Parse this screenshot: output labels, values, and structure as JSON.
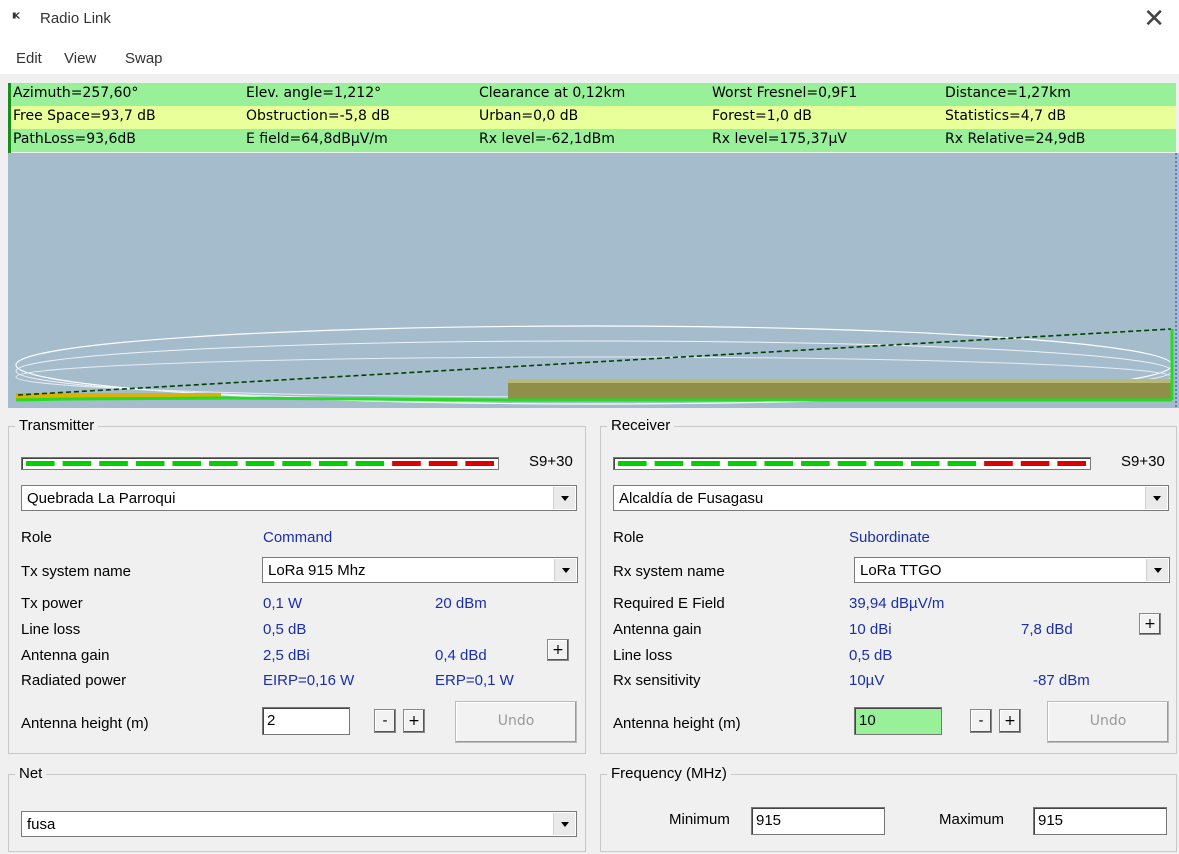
{
  "window": {
    "title": "Radio Link",
    "icon": "radio-link-app-icon",
    "close_glyph": "✕"
  },
  "menu": [
    "Edit",
    "View",
    "Swap"
  ],
  "stats": [
    [
      "Azimuth=257,60°",
      "Elev. angle=1,212°",
      "Clearance at 0,12km",
      "Worst Fresnel=0,9F1",
      "Distance=1,27km"
    ],
    [
      "Free Space=93,7 dB",
      "Obstruction=-5,8 dB",
      "Urban=0,0 dB",
      "Forest=1,0 dB",
      "Statistics=4,7 dB"
    ],
    [
      "PathLoss=93,6dB",
      "E field=64,8dBµV/m",
      "Rx level=-62,1dBm",
      "Rx level=175,37µV",
      "Rx Relative=24,9dB"
    ]
  ],
  "colors": {
    "stat_green": "#98f098",
    "stat_yellow": "#e8ff9a",
    "profile_bg": "#a5bccd",
    "meter_green": "#00d000",
    "meter_red": "#dd0000",
    "value_blue": "#1a2fa8"
  },
  "transmitter": {
    "title": "Transmitter",
    "signal_label": "S9+30",
    "meter": {
      "green_segments": 10,
      "red_segments": 3
    },
    "site": "Quebrada La Parroqui",
    "role_label": "Role",
    "role_value": "Command",
    "system_label": "Tx system name",
    "system_value": "LoRa 915 Mhz",
    "power_label": "Tx power",
    "power_w": "0,1 W",
    "power_dbm": "20 dBm",
    "line_loss_label": "Line loss",
    "line_loss_value": "0,5 dB",
    "gain_label": "Antenna gain",
    "gain_dbi": "2,5 dBi",
    "gain_dbd": "0,4 dBd",
    "radiated_label": "Radiated power",
    "eirp": "EIRP=0,16 W",
    "erp": "ERP=0,1 W",
    "height_label": "Antenna height (m)",
    "height_value": "2",
    "minus": "-",
    "plus": "+",
    "undo": "Undo"
  },
  "receiver": {
    "title": "Receiver",
    "signal_label": "S9+30",
    "meter": {
      "green_segments": 10,
      "red_segments": 3
    },
    "site": "Alcaldía de Fusagasu",
    "role_label": "Role",
    "role_value": "Subordinate",
    "system_label": "Rx system name",
    "system_value": "LoRa TTGO",
    "efield_label": "Required E Field",
    "efield_value": "39,94 dBµV/m",
    "gain_label": "Antenna gain",
    "gain_dbi": "10 dBi",
    "gain_dbd": "7,8 dBd",
    "line_loss_label": "Line loss",
    "line_loss_value": "0,5 dB",
    "sens_label": "Rx sensitivity",
    "sens_uv": "10µV",
    "sens_dbm": "-87 dBm",
    "height_label": "Antenna height (m)",
    "height_value": "10",
    "minus": "-",
    "plus": "+",
    "undo": "Undo"
  },
  "net": {
    "title": "Net",
    "value": "fusa"
  },
  "frequency": {
    "title": "Frequency (MHz)",
    "min_label": "Minimum",
    "min_value": "915",
    "max_label": "Maximum",
    "max_value": "915"
  }
}
